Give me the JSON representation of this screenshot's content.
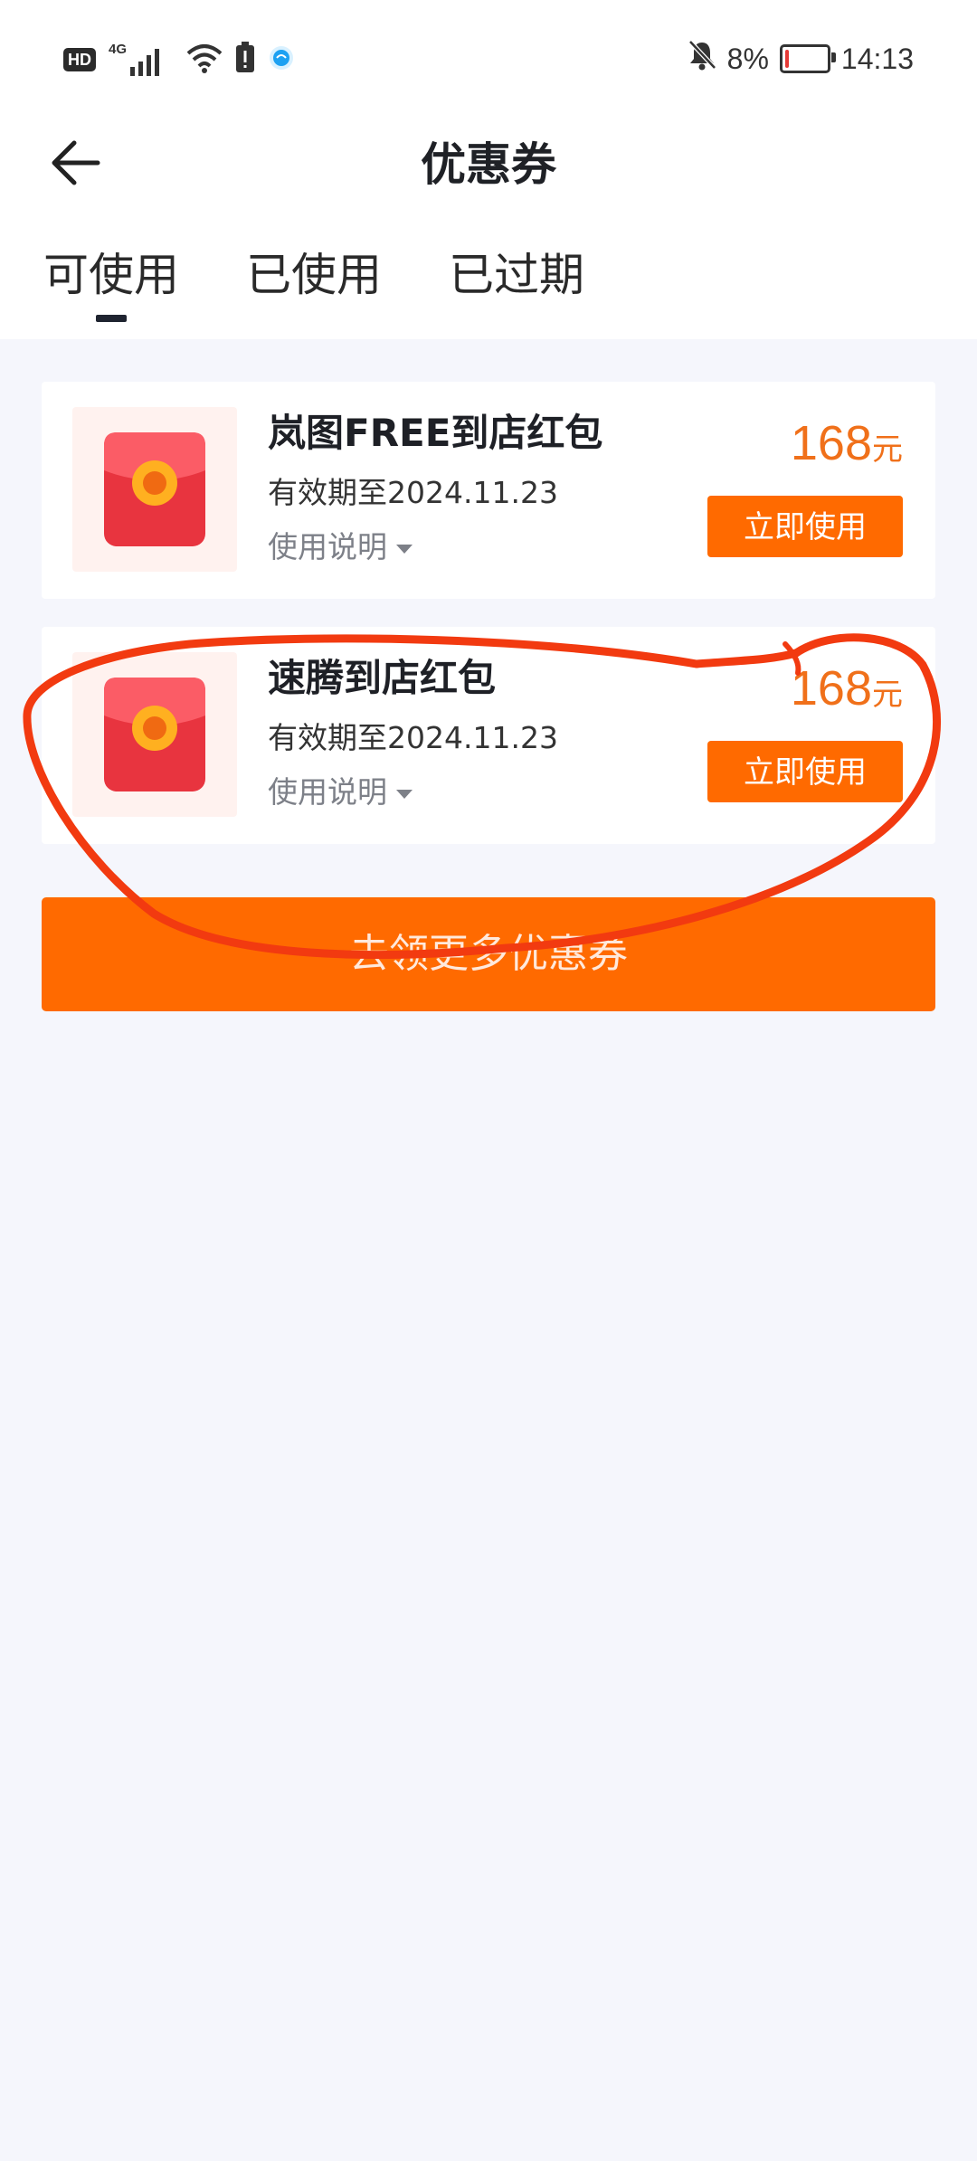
{
  "status_bar": {
    "hd": "HD",
    "network": "4G",
    "battery_percent": "8%",
    "battery_level": 0.08,
    "time": "14:13",
    "icons": [
      "hd-badge",
      "signal-icon",
      "wifi-icon",
      "alert-icon",
      "app-icon",
      "bell-off-icon",
      "battery-icon"
    ]
  },
  "header": {
    "title": "优惠券",
    "back_icon": "arrow-left-icon"
  },
  "tabs": [
    {
      "label": "可使用",
      "active": true
    },
    {
      "label": "已使用",
      "active": false
    },
    {
      "label": "已过期",
      "active": false
    }
  ],
  "coupons": [
    {
      "title": "岚图FREE到店红包",
      "validity": "有效期至2024.11.23",
      "note_label": "使用说明",
      "amount": "168",
      "unit": "元",
      "button_label": "立即使用",
      "icon": "red-envelope-icon"
    },
    {
      "title": "速腾到店红包",
      "validity": "有效期至2024.11.23",
      "note_label": "使用说明",
      "amount": "168",
      "unit": "元",
      "button_label": "立即使用",
      "icon": "red-envelope-icon"
    }
  ],
  "more_button": {
    "label": "去领更多优惠券"
  },
  "colors": {
    "accent": "#ff6a00",
    "amount": "#f0701a",
    "page_bg": "#f5f6fc",
    "annotation": "#f23a10"
  }
}
